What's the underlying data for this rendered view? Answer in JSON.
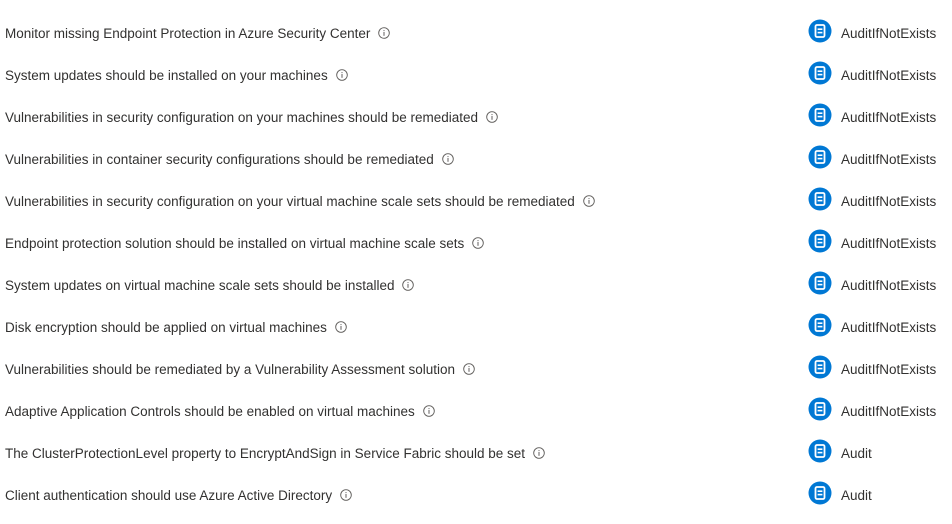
{
  "colors": {
    "text": "#323130",
    "info_icon": "#605e5c",
    "effect_icon": "#0078d4"
  },
  "icons": {
    "info": "info-circle-icon",
    "effect": "policy-effect-icon"
  },
  "policies": [
    {
      "name": "Monitor missing Endpoint Protection in Azure Security Center",
      "effect": "AuditIfNotExists"
    },
    {
      "name": "System updates should be installed on your machines",
      "effect": "AuditIfNotExists"
    },
    {
      "name": "Vulnerabilities in security configuration on your machines should be remediated",
      "effect": "AuditIfNotExists"
    },
    {
      "name": "Vulnerabilities in container security configurations should be remediated",
      "effect": "AuditIfNotExists"
    },
    {
      "name": "Vulnerabilities in security configuration on your virtual machine scale sets should be remediated",
      "effect": "AuditIfNotExists"
    },
    {
      "name": "Endpoint protection solution should be installed on virtual machine scale sets",
      "effect": "AuditIfNotExists"
    },
    {
      "name": "System updates on virtual machine scale sets should be installed",
      "effect": "AuditIfNotExists"
    },
    {
      "name": "Disk encryption should be applied on virtual machines",
      "effect": "AuditIfNotExists"
    },
    {
      "name": "Vulnerabilities should be remediated by a Vulnerability Assessment solution",
      "effect": "AuditIfNotExists"
    },
    {
      "name": "Adaptive Application Controls should be enabled on virtual machines",
      "effect": "AuditIfNotExists"
    },
    {
      "name": "The ClusterProtectionLevel property to EncryptAndSign in Service Fabric should be set",
      "effect": "Audit"
    },
    {
      "name": "Client authentication should use Azure Active Directory",
      "effect": "Audit"
    }
  ]
}
